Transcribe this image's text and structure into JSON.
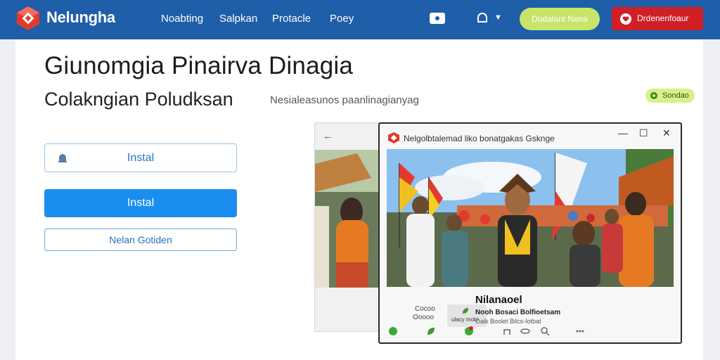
{
  "header": {
    "brand": "Nelungha",
    "nav": [
      "Noabting",
      "Salpkan",
      "Protacle",
      "Poey"
    ],
    "btn_green": "Dodalant Nena",
    "btn_red": "Drdenenfoaur"
  },
  "main": {
    "title": "Giunomgia Pinairva Dinagia",
    "subtitle": "Colakngian Poludksan",
    "tagline": "Nesialeasunos paanlinagianyag",
    "badge": "Sondao",
    "input_label": "Instal",
    "primary_label": "Instal",
    "secondary_label": "Nelan Gotiden"
  },
  "preview": {
    "window_title": "Nelgolbtalemad liko bonatgakas Gsknge",
    "caption_name": "Nilanaoel",
    "caption_line": "Nooh Bosaci Bolfioetsam",
    "caption_sub": "Oaik Boolet Bilcs-Iotbat",
    "mini_a": "Cocoo",
    "mini_b": "Ooooo",
    "mini_card_label": "ulacy mobi"
  },
  "colors": {
    "header": "#1f5ea8",
    "primary": "#1a8ef0",
    "green": "#c7e46b",
    "red": "#d01f25"
  }
}
